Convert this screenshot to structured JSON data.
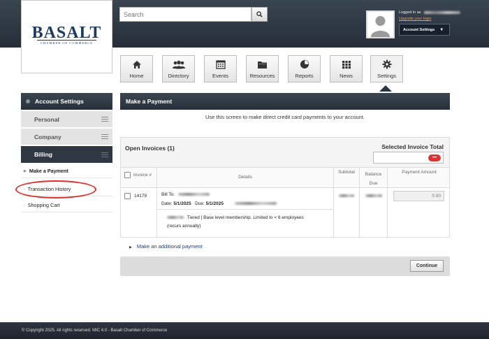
{
  "header": {
    "logo_name": "BASALT",
    "logo_subtitle": "CHAMBER OF COMMERCE",
    "search_placeholder": "Search",
    "user": {
      "logged_in_label": "Logged in as",
      "upgrade_link": "Upgrade your login",
      "account_settings_button": "Account Settings"
    }
  },
  "nav": {
    "items": [
      {
        "label": "Home",
        "icon": "home-icon"
      },
      {
        "label": "Directory",
        "icon": "people-icon"
      },
      {
        "label": "Events",
        "icon": "calendar-icon"
      },
      {
        "label": "Resources",
        "icon": "folder-icon"
      },
      {
        "label": "Reports",
        "icon": "pie-chart-icon"
      },
      {
        "label": "News",
        "icon": "grid-icon"
      },
      {
        "label": "Settings",
        "icon": "gear-icon"
      }
    ],
    "active": "Settings"
  },
  "sidebar": {
    "header": "Account Settings",
    "sections": [
      {
        "label": "Personal"
      },
      {
        "label": "Company"
      },
      {
        "label": "Billing"
      }
    ],
    "items": [
      {
        "label": "Make a Payment"
      },
      {
        "label": "Transaction History"
      },
      {
        "label": "Shopping Cart"
      }
    ]
  },
  "main": {
    "title": "Make a Payment",
    "intro": "Use this screen to make direct credit card payments to your account.",
    "open_invoices_label": "Open Invoices (1)",
    "selected_total_label": "Selected Invoice Total",
    "table": {
      "headers": {
        "invoice": "Invoice #",
        "details": "Details",
        "subtotal": "Subtotal",
        "balance_due": "Balance Due",
        "payment_amount": "Payment Amount"
      },
      "row": {
        "invoice_number": "14179",
        "bill_to_label": "Bill To:",
        "date_label": "Date:",
        "date": "5/1/2025",
        "due_label": "Due:",
        "due_date": "5/1/2025",
        "description": "Tiered | Base level membership. Limited to < 6 employees (recurs annually)",
        "payment_placeholder": "0.00"
      }
    },
    "add_payment_link": "Make an additional payment",
    "continue_button": "Continue"
  },
  "footer": {
    "text": "© Copyright 2025. All rights reserved. MIC 4.0 - Basalt Chamber of Commerce"
  },
  "colors": {
    "header_dark": "#2c3540",
    "brand_navy": "#1d3a63",
    "accent_orange": "#f29a38",
    "highlight_red": "#d9302b",
    "link_blue": "#1f3f73"
  }
}
